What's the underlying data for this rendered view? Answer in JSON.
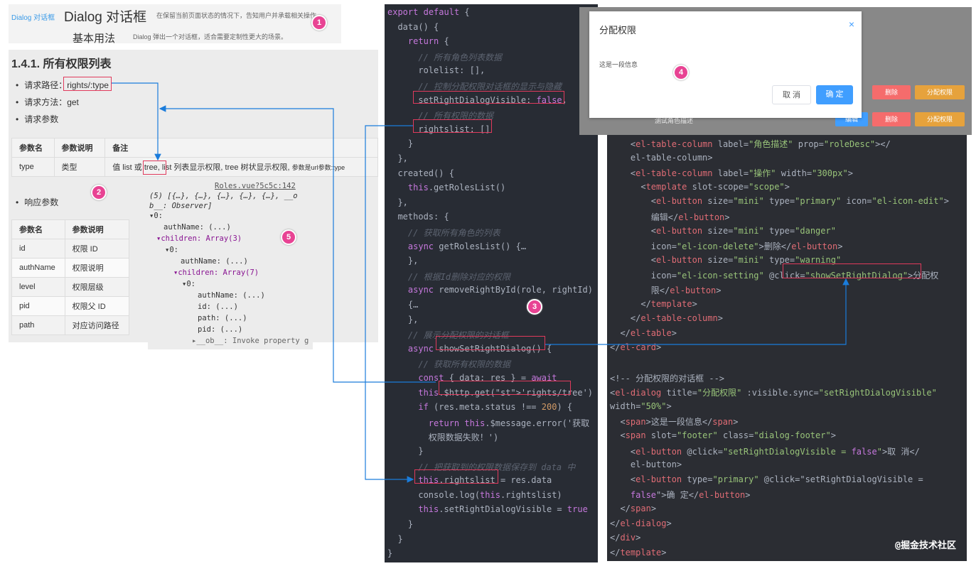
{
  "panel1": {
    "link": "Dialog 对话框",
    "title": "Dialog 对话框",
    "desc": "在保留当前页面状态的情况下，告知用户并承载相关操作。",
    "subtitle": "基本用法",
    "subdesc": "Dialog 弹出一个对话框，适合需要定制性更大的场景。"
  },
  "doc": {
    "heading": "1.4.1. 所有权限列表",
    "req_path_label": "请求路径：",
    "req_path_value": "rights/:type",
    "req_method": "请求方法：get",
    "req_params": "请求参数",
    "params_headers": [
      "参数名",
      "参数说明",
      "备注"
    ],
    "params_row": [
      "type",
      "类型"
    ],
    "params_note_a": "值 list 或",
    "params_note_tree": "tree",
    "params_note_b": ", list 列表显示权限, tree 树状显示权限,",
    "params_note_c": "参数是url参数:type",
    "resp_params": "响应参数",
    "resp_headers": [
      "参数名",
      "参数说明"
    ],
    "resp_rows": [
      [
        "id",
        "权限 ID"
      ],
      [
        "authName",
        "权限说明"
      ],
      [
        "level",
        "权限层级"
      ],
      [
        "pid",
        "权限父 ID"
      ],
      [
        "path",
        "对应访问路径"
      ]
    ]
  },
  "console": {
    "source": "Roles.vue?5c5c:142",
    "lines": [
      "(5) [{…}, {…}, {…}, {…}, {…}, __o",
      "b__: Observer]",
      "▾0:",
      "authName: (...)",
      "▾children: Array(3)",
      "▾0:",
      "authName: (...)",
      "▾children: Array(7)",
      "▾0:",
      "authName: (...)",
      "id: (...)",
      "path: (...)",
      "pid: (...)",
      "▸__ob__: Invoke property g"
    ]
  },
  "markers": [
    "1",
    "2",
    "3",
    "4",
    "5"
  ],
  "code_left": [
    "export default {",
    "  data() {",
    "    return {",
    "      // 所有角色列表数据",
    "      rolelist: [],",
    "      // 控制分配权限对话框的显示与隐藏",
    "      setRightDialogVisible: false,",
    "      // 所有权限的数据",
    "      rightslist: []",
    "    }",
    "  },",
    "  created() {",
    "    this.getRolesList()",
    "  },",
    "  methods: {",
    "    // 获取所有角色的列表",
    "    async getRolesList() {…",
    "    },",
    "    // 根据Id删除对应的权限",
    "    async removeRightById(role, rightId)",
    "    {…",
    "    },",
    "    // 展示分配权限的对话框",
    "    async showSetRightDialog() {",
    "      // 获取所有权限的数据",
    "      const { data: res } = await",
    "      this.$http.get('rights/tree')",
    "      if (res.meta.status !== 200) {",
    "        return this.$message.error('获取",
    "        权限数据失败！')",
    "      }",
    "      // 把获取到的权限数据保存到 data 中",
    "      this.rightslist = res.data",
    "      console.log(this.rightslist)",
    "      this.setRightDialogVisible = true",
    "    }",
    "  }",
    "}"
  ],
  "code_right": [
    "    <el-table-column label=\"角色描述\" prop=\"roleDesc\"></",
    "    el-table-column>",
    "    <el-table-column label=\"操作\" width=\"300px\">",
    "      <template slot-scope=\"scope\">",
    "        <el-button size=\"mini\" type=\"primary\" icon=\"el-icon-edit\">",
    "        编辑</el-button>",
    "        <el-button size=\"mini\" type=\"danger\"",
    "        icon=\"el-icon-delete\">删除</el-button>",
    "        <el-button size=\"mini\" type=\"warning\"",
    "        icon=\"el-icon-setting\" @click=\"showSetRightDialog\">分配权",
    "        限</el-button>",
    "      </template>",
    "    </el-table-column>",
    "  </el-table>",
    "</el-card>",
    "",
    "<!-- 分配权限的对话框 -->",
    "<el-dialog title=\"分配权限\" :visible.sync=\"setRightDialogVisible\"",
    "width=\"50%\">",
    "  <span>这是一段信息</span>",
    "  <span slot=\"footer\" class=\"dialog-footer\">",
    "    <el-button @click=\"setRightDialogVisible = false\">取 消</",
    "    el-button>",
    "    <el-button type=\"primary\" @click=\"setRightDialogVisible =",
    "    false\">确 定</el-button>",
    "  </span>",
    "</el-dialog>",
    "</div>",
    "</template>"
  ],
  "dialog": {
    "title": "分配权限",
    "close": "×",
    "body": "这是一段信息",
    "cancel": "取 消",
    "confirm": "确 定",
    "bg_buttons": [
      "编辑",
      "删除",
      "分配权限"
    ],
    "bg_text": "测试角色描述"
  },
  "watermark": "@掘金技术社区",
  "colors": {
    "accent": "#e03a5c",
    "link": "#1a7cdb",
    "marker": "#e84393"
  }
}
